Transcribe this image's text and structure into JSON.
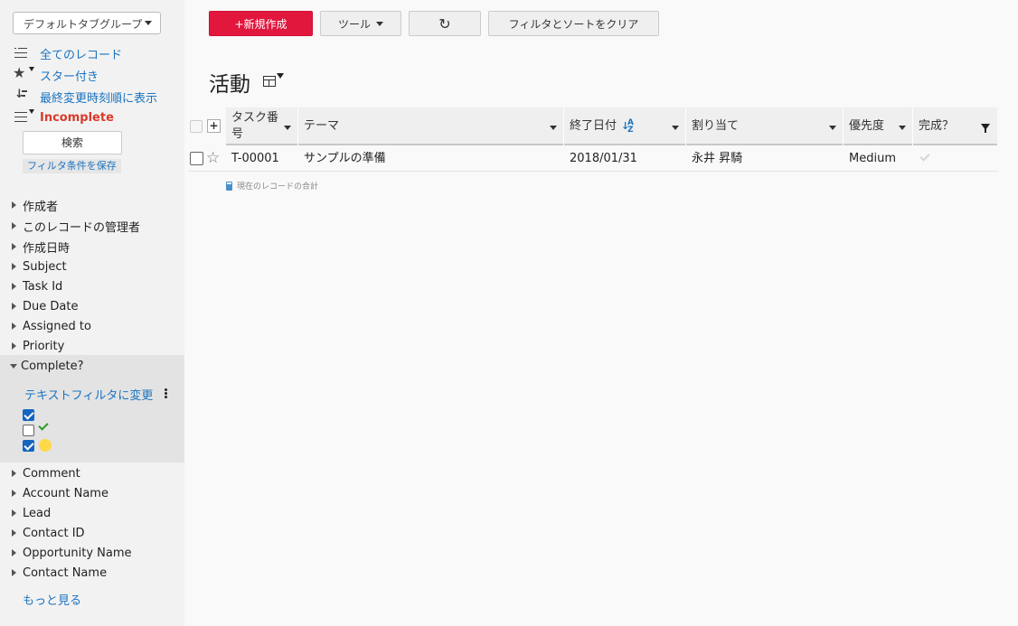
{
  "sidebar": {
    "tag_group": "デフォルトタブグループ",
    "views": [
      {
        "label": "全てのレコード",
        "icon": "list-icon"
      },
      {
        "label": "スター付き",
        "icon": "star-icon"
      },
      {
        "label": "最終変更時刻順に表示",
        "icon": "sort-icon"
      },
      {
        "label": "Incomplete",
        "icon": "filtered-list-icon"
      }
    ],
    "search_button": "検索",
    "save_filter": "フィルタ条件を保存",
    "facets_top": [
      "作成者",
      "このレコードの管理者",
      "作成日時",
      "Subject",
      "Task Id",
      "Due Date",
      "Assigned to",
      "Priority"
    ],
    "open_facet": {
      "label": "Complete?",
      "text_filter_link": "テキストフィルタに変更",
      "options": [
        {
          "checked": true,
          "icon": "blank"
        },
        {
          "checked": false,
          "icon": "check-icon"
        },
        {
          "checked": true,
          "icon": "yellow-dot-icon"
        }
      ]
    },
    "facets_bottom": [
      "Comment",
      "Account Name",
      "Lead",
      "Contact ID",
      "Opportunity Name",
      "Contact Name"
    ],
    "more_link": "もっと見る"
  },
  "toolbar": {
    "new_label": "+新規作成",
    "tools_label": "ツール",
    "refresh_icon": "refresh-icon",
    "clear_label": "フィルタとソートをクリア"
  },
  "page": {
    "title": "活動",
    "title_icon": "table-view-icon"
  },
  "table": {
    "columns": [
      "タスク番号",
      "テーマ",
      "終了日付",
      "割り当て",
      "優先度",
      "完成？"
    ],
    "sort_icon": "sort-az-icon",
    "rows": [
      {
        "task_id": "T-00001",
        "theme": "サンプルの準備",
        "end_date": "2018/01/31",
        "assignee": "永井 昇騎",
        "priority": "Medium",
        "complete": true
      }
    ],
    "total_label": "現在のレコードの合計"
  },
  "colors": {
    "primary": "#e2173e",
    "link": "#1a73c0",
    "active_view": "#d93a2b"
  }
}
